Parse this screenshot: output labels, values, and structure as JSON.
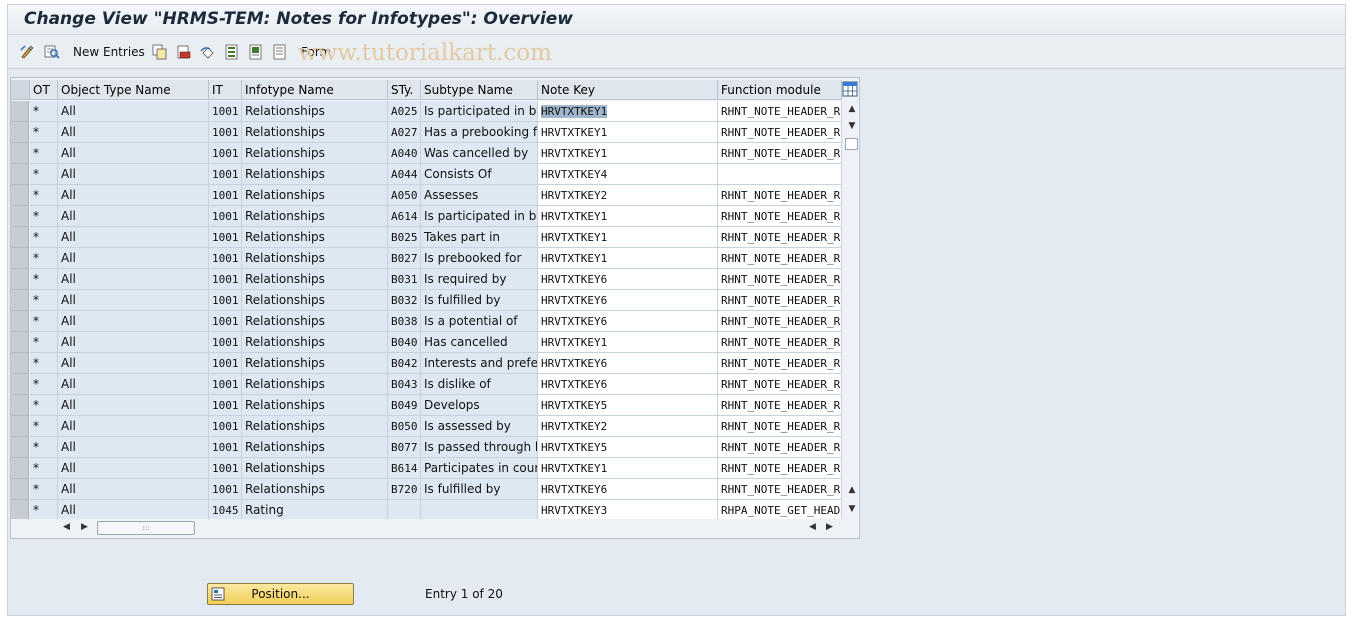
{
  "window": {
    "title": "Change View \"HRMS-TEM: Notes for Infotypes\": Overview"
  },
  "toolbar": {
    "new_entries_label": "New Entries",
    "form_label": "Form",
    "watermark": "www.tutorialkart.com"
  },
  "table": {
    "columns": [
      "OT",
      "Object Type Name",
      "IT",
      "Infotype Name",
      "STy.",
      "Subtype Name",
      "Note Key",
      "Function module"
    ],
    "rows": [
      {
        "ot": "*",
        "otname": "All",
        "it": "1001",
        "itname": "Relationships",
        "sty": "A025",
        "stname": "Is participated in by",
        "notekey": "HRVTXTKEY1",
        "fm": "RHNT_NOTE_HEADER_R"
      },
      {
        "ot": "*",
        "otname": "All",
        "it": "1001",
        "itname": "Relationships",
        "sty": "A027",
        "stname": "Has a prebooking for",
        "notekey": "HRVTXTKEY1",
        "fm": "RHNT_NOTE_HEADER_R"
      },
      {
        "ot": "*",
        "otname": "All",
        "it": "1001",
        "itname": "Relationships",
        "sty": "A040",
        "stname": "Was cancelled by",
        "notekey": "HRVTXTKEY1",
        "fm": "RHNT_NOTE_HEADER_R"
      },
      {
        "ot": "*",
        "otname": "All",
        "it": "1001",
        "itname": "Relationships",
        "sty": "A044",
        "stname": "Consists Of",
        "notekey": "HRVTXTKEY4",
        "fm": ""
      },
      {
        "ot": "*",
        "otname": "All",
        "it": "1001",
        "itname": "Relationships",
        "sty": "A050",
        "stname": "Assesses",
        "notekey": "HRVTXTKEY2",
        "fm": "RHNT_NOTE_HEADER_R"
      },
      {
        "ot": "*",
        "otname": "All",
        "it": "1001",
        "itname": "Relationships",
        "sty": "A614",
        "stname": "Is participated in by",
        "notekey": "HRVTXTKEY1",
        "fm": "RHNT_NOTE_HEADER_R"
      },
      {
        "ot": "*",
        "otname": "All",
        "it": "1001",
        "itname": "Relationships",
        "sty": "B025",
        "stname": "Takes part in",
        "notekey": "HRVTXTKEY1",
        "fm": "RHNT_NOTE_HEADER_R"
      },
      {
        "ot": "*",
        "otname": "All",
        "it": "1001",
        "itname": "Relationships",
        "sty": "B027",
        "stname": "Is prebooked for",
        "notekey": "HRVTXTKEY1",
        "fm": "RHNT_NOTE_HEADER_R"
      },
      {
        "ot": "*",
        "otname": "All",
        "it": "1001",
        "itname": "Relationships",
        "sty": "B031",
        "stname": "Is required by",
        "notekey": "HRVTXTKEY6",
        "fm": "RHNT_NOTE_HEADER_R"
      },
      {
        "ot": "*",
        "otname": "All",
        "it": "1001",
        "itname": "Relationships",
        "sty": "B032",
        "stname": "Is fulfilled by",
        "notekey": "HRVTXTKEY6",
        "fm": "RHNT_NOTE_HEADER_R"
      },
      {
        "ot": "*",
        "otname": "All",
        "it": "1001",
        "itname": "Relationships",
        "sty": "B038",
        "stname": "Is a potential of",
        "notekey": "HRVTXTKEY6",
        "fm": "RHNT_NOTE_HEADER_R"
      },
      {
        "ot": "*",
        "otname": "All",
        "it": "1001",
        "itname": "Relationships",
        "sty": "B040",
        "stname": "Has cancelled",
        "notekey": "HRVTXTKEY1",
        "fm": "RHNT_NOTE_HEADER_R"
      },
      {
        "ot": "*",
        "otname": "All",
        "it": "1001",
        "itname": "Relationships",
        "sty": "B042",
        "stname": "Interests and prefer...",
        "notekey": "HRVTXTKEY6",
        "fm": "RHNT_NOTE_HEADER_R"
      },
      {
        "ot": "*",
        "otname": "All",
        "it": "1001",
        "itname": "Relationships",
        "sty": "B043",
        "stname": "Is dislike of",
        "notekey": "HRVTXTKEY6",
        "fm": "RHNT_NOTE_HEADER_R"
      },
      {
        "ot": "*",
        "otname": "All",
        "it": "1001",
        "itname": "Relationships",
        "sty": "B049",
        "stname": "Develops",
        "notekey": "HRVTXTKEY5",
        "fm": "RHNT_NOTE_HEADER_R"
      },
      {
        "ot": "*",
        "otname": "All",
        "it": "1001",
        "itname": "Relationships",
        "sty": "B050",
        "stname": "Is assessed by",
        "notekey": "HRVTXTKEY2",
        "fm": "RHNT_NOTE_HEADER_R"
      },
      {
        "ot": "*",
        "otname": "All",
        "it": "1001",
        "itname": "Relationships",
        "sty": "B077",
        "stname": "Is passed through by",
        "notekey": "HRVTXTKEY5",
        "fm": "RHNT_NOTE_HEADER_R"
      },
      {
        "ot": "*",
        "otname": "All",
        "it": "1001",
        "itname": "Relationships",
        "sty": "B614",
        "stname": "Participates in course",
        "notekey": "HRVTXTKEY1",
        "fm": "RHNT_NOTE_HEADER_R"
      },
      {
        "ot": "*",
        "otname": "All",
        "it": "1001",
        "itname": "Relationships",
        "sty": "B720",
        "stname": "Is fulfilled by",
        "notekey": "HRVTXTKEY6",
        "fm": "RHNT_NOTE_HEADER_R"
      },
      {
        "ot": "*",
        "otname": "All",
        "it": "1045",
        "itname": "Rating",
        "sty": "",
        "stname": "",
        "notekey": "HRVTXTKEY3",
        "fm": "RHPA_NOTE_GET_HEADER"
      }
    ]
  },
  "footer": {
    "position_label": "Position...",
    "entry_text": "Entry 1 of 20"
  },
  "colors": {
    "position_button": "#f1cf5a",
    "cell_background": "#dde8f2",
    "selected_text_highlight": "#9fb6cd"
  }
}
